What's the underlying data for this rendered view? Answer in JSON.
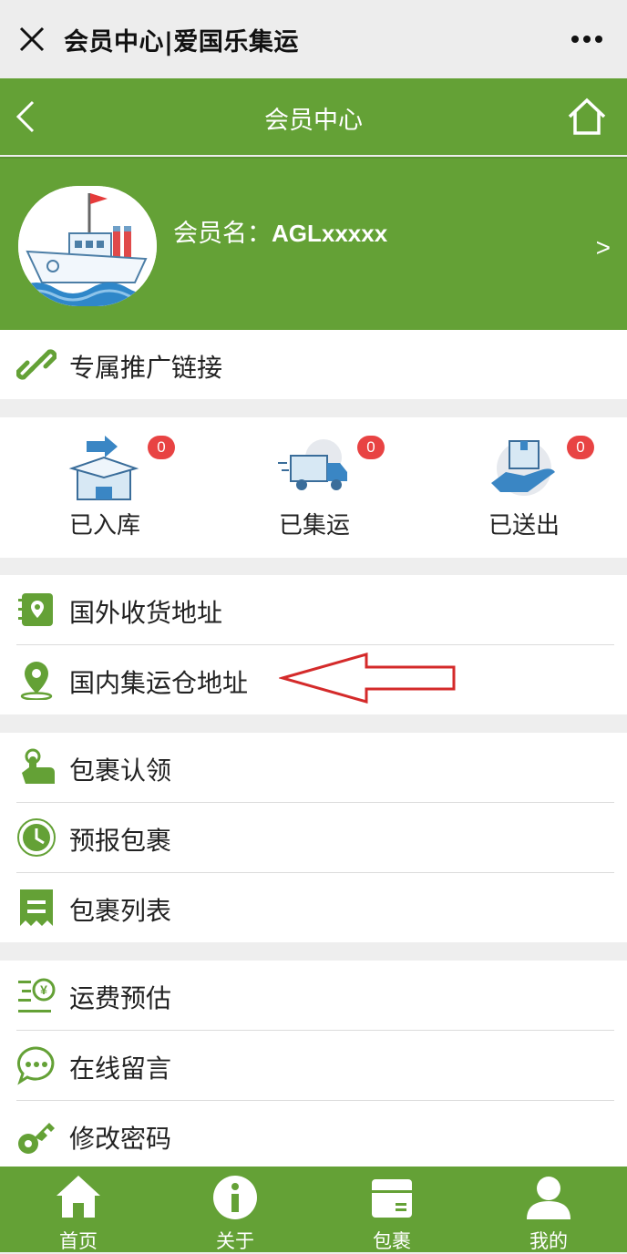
{
  "window": {
    "title": "会员中心|爱国乐集运"
  },
  "header": {
    "title": "会员中心"
  },
  "member": {
    "name_label": "会员名：",
    "name_value": "AGLxxxxx",
    "arrow": ">"
  },
  "promo": {
    "label": "专属推广链接"
  },
  "stats": [
    {
      "label": "已入库",
      "count": "0"
    },
    {
      "label": "已集运",
      "count": "0"
    },
    {
      "label": "已送出",
      "count": "0"
    }
  ],
  "address_menu": [
    {
      "label": "国外收货地址"
    },
    {
      "label": "国内集运仓地址"
    }
  ],
  "parcel_menu": [
    {
      "label": "包裹认领"
    },
    {
      "label": "预报包裹"
    },
    {
      "label": "包裹列表"
    }
  ],
  "other_menu": [
    {
      "label": "运费预估"
    },
    {
      "label": "在线留言"
    },
    {
      "label": "修改密码"
    }
  ],
  "tabbar": [
    {
      "label": "首页"
    },
    {
      "label": "关于"
    },
    {
      "label": "包裹"
    },
    {
      "label": "我的"
    }
  ],
  "colors": {
    "brand_green": "#64a136",
    "badge_red": "#e84343",
    "annotation_arrow": "#d42a2a"
  }
}
